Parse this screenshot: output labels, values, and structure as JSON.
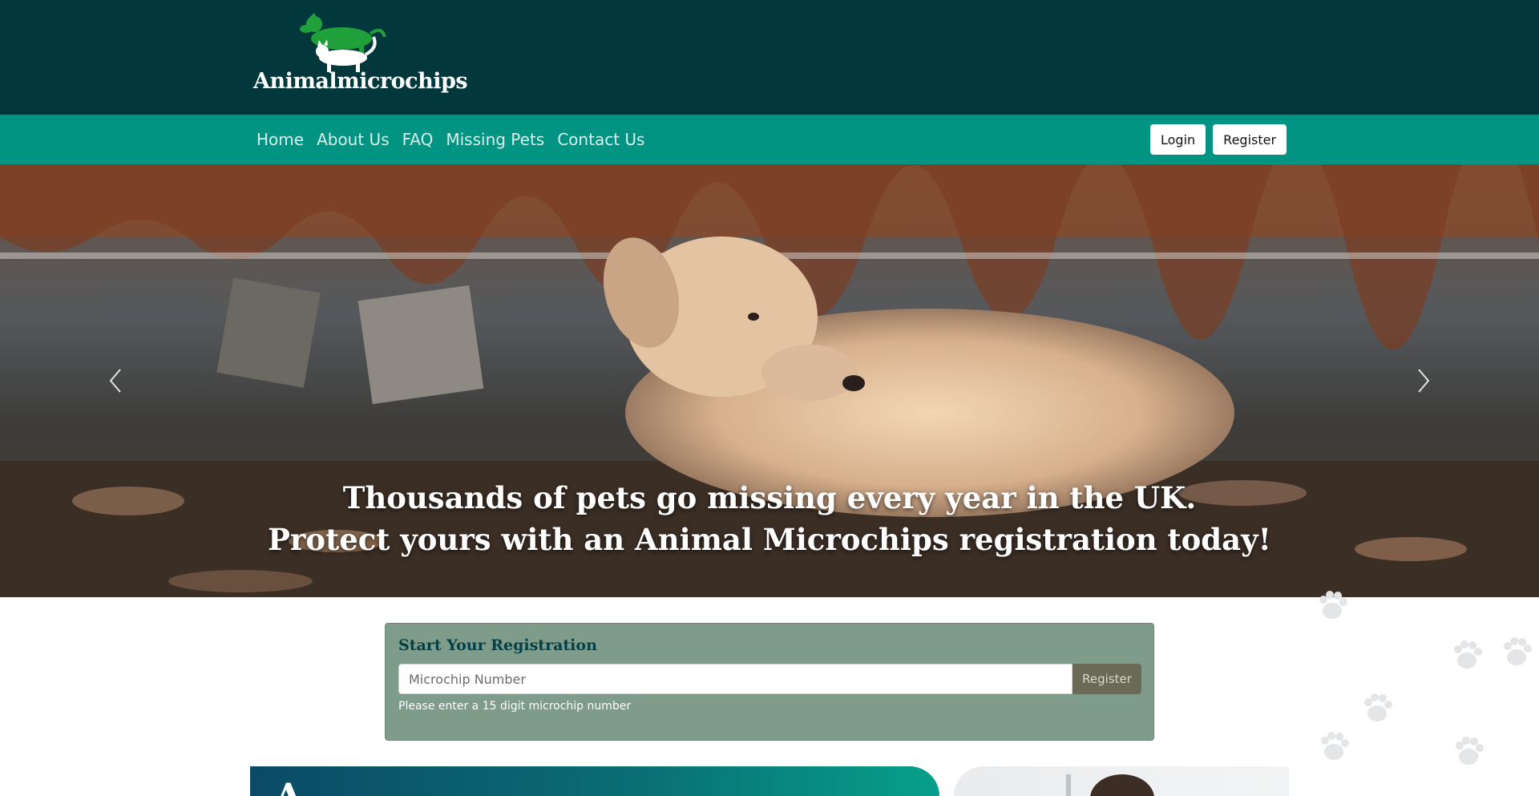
{
  "brand": {
    "logo_text": "Animalmicrochips"
  },
  "nav": {
    "links": [
      "Home",
      "About Us",
      "FAQ",
      "Missing Pets",
      "Contact Us"
    ],
    "login_label": "Login",
    "register_label": "Register"
  },
  "hero": {
    "line1": "Thousands of pets go missing every year in the UK.",
    "line2": "Protect yours with an Animal Microchips registration today!"
  },
  "registration": {
    "title": "Start Your Registration",
    "input_placeholder": "Microchip Number",
    "button_label": "Register",
    "help_text": "Please enter a 15 digit microchip number"
  },
  "colors": {
    "topbar": "#02373c",
    "navbar": "#029482",
    "card": "#7f9b8a"
  },
  "icons": [
    "chevron-left-icon",
    "chevron-right-icon",
    "paw-print-icon"
  ]
}
